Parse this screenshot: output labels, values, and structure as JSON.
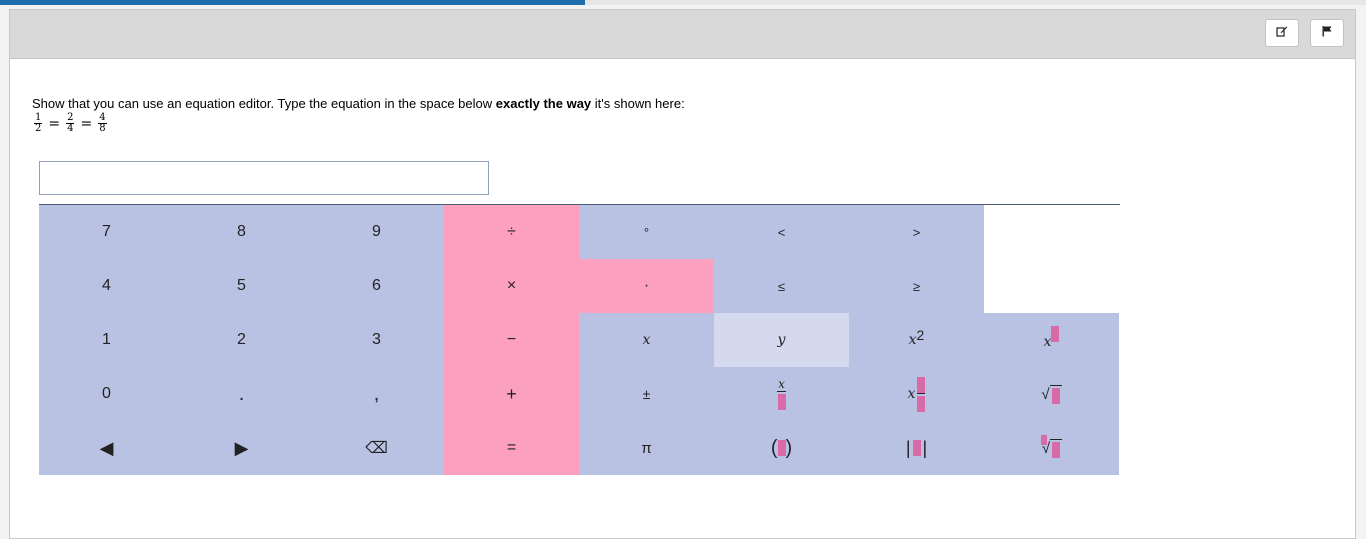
{
  "progress": {
    "value_fraction": 0.428
  },
  "header": {
    "edit_icon": "edit-icon",
    "flag_icon": "flag-icon"
  },
  "question": {
    "instruction_before": "Show that you can use an equation editor. Type the equation in the space below ",
    "instruction_bold": "exactly the way",
    "instruction_after": " it's shown here:",
    "equation": {
      "f1_num": "1",
      "f1_den": "2",
      "eq1": "=",
      "f2_num": "2",
      "f2_den": "4",
      "eq2": "=",
      "f3_num": "4",
      "f3_den": "8"
    }
  },
  "answer": {
    "value": "",
    "placeholder": ""
  },
  "keypad": {
    "k7": "7",
    "k8": "8",
    "k9": "9",
    "divide": "÷",
    "degree": "°",
    "less": "<",
    "greater": ">",
    "k4": "4",
    "k5": "5",
    "k6": "6",
    "times": "×",
    "dot": "·",
    "leq": "≤",
    "geq": "≥",
    "k1": "1",
    "k2": "2",
    "k3": "3",
    "minus": "−",
    "x": "x",
    "y": "y",
    "x_squared_base": "x",
    "x_squared_exp": "2",
    "x_power_base": "x",
    "k0": "0",
    "decimal": ".",
    "comma": ",",
    "plus": "+",
    "plusminus": "±",
    "fraction_num": "x",
    "mixed_x": "x",
    "sqrt_symbol": "√",
    "left_arrow": "◀",
    "right_arrow": "▶",
    "backspace": "⌫",
    "equals": "=",
    "pi": "π",
    "paren_open": "(",
    "paren_close": ")",
    "abs_bar": "|",
    "nthroot_symbol": "√"
  },
  "colors": {
    "operator_keys": "#fca0c0",
    "math_keys": "#bac2e4",
    "placeholder": "#d86aa8",
    "progress": "#1f6fae"
  }
}
